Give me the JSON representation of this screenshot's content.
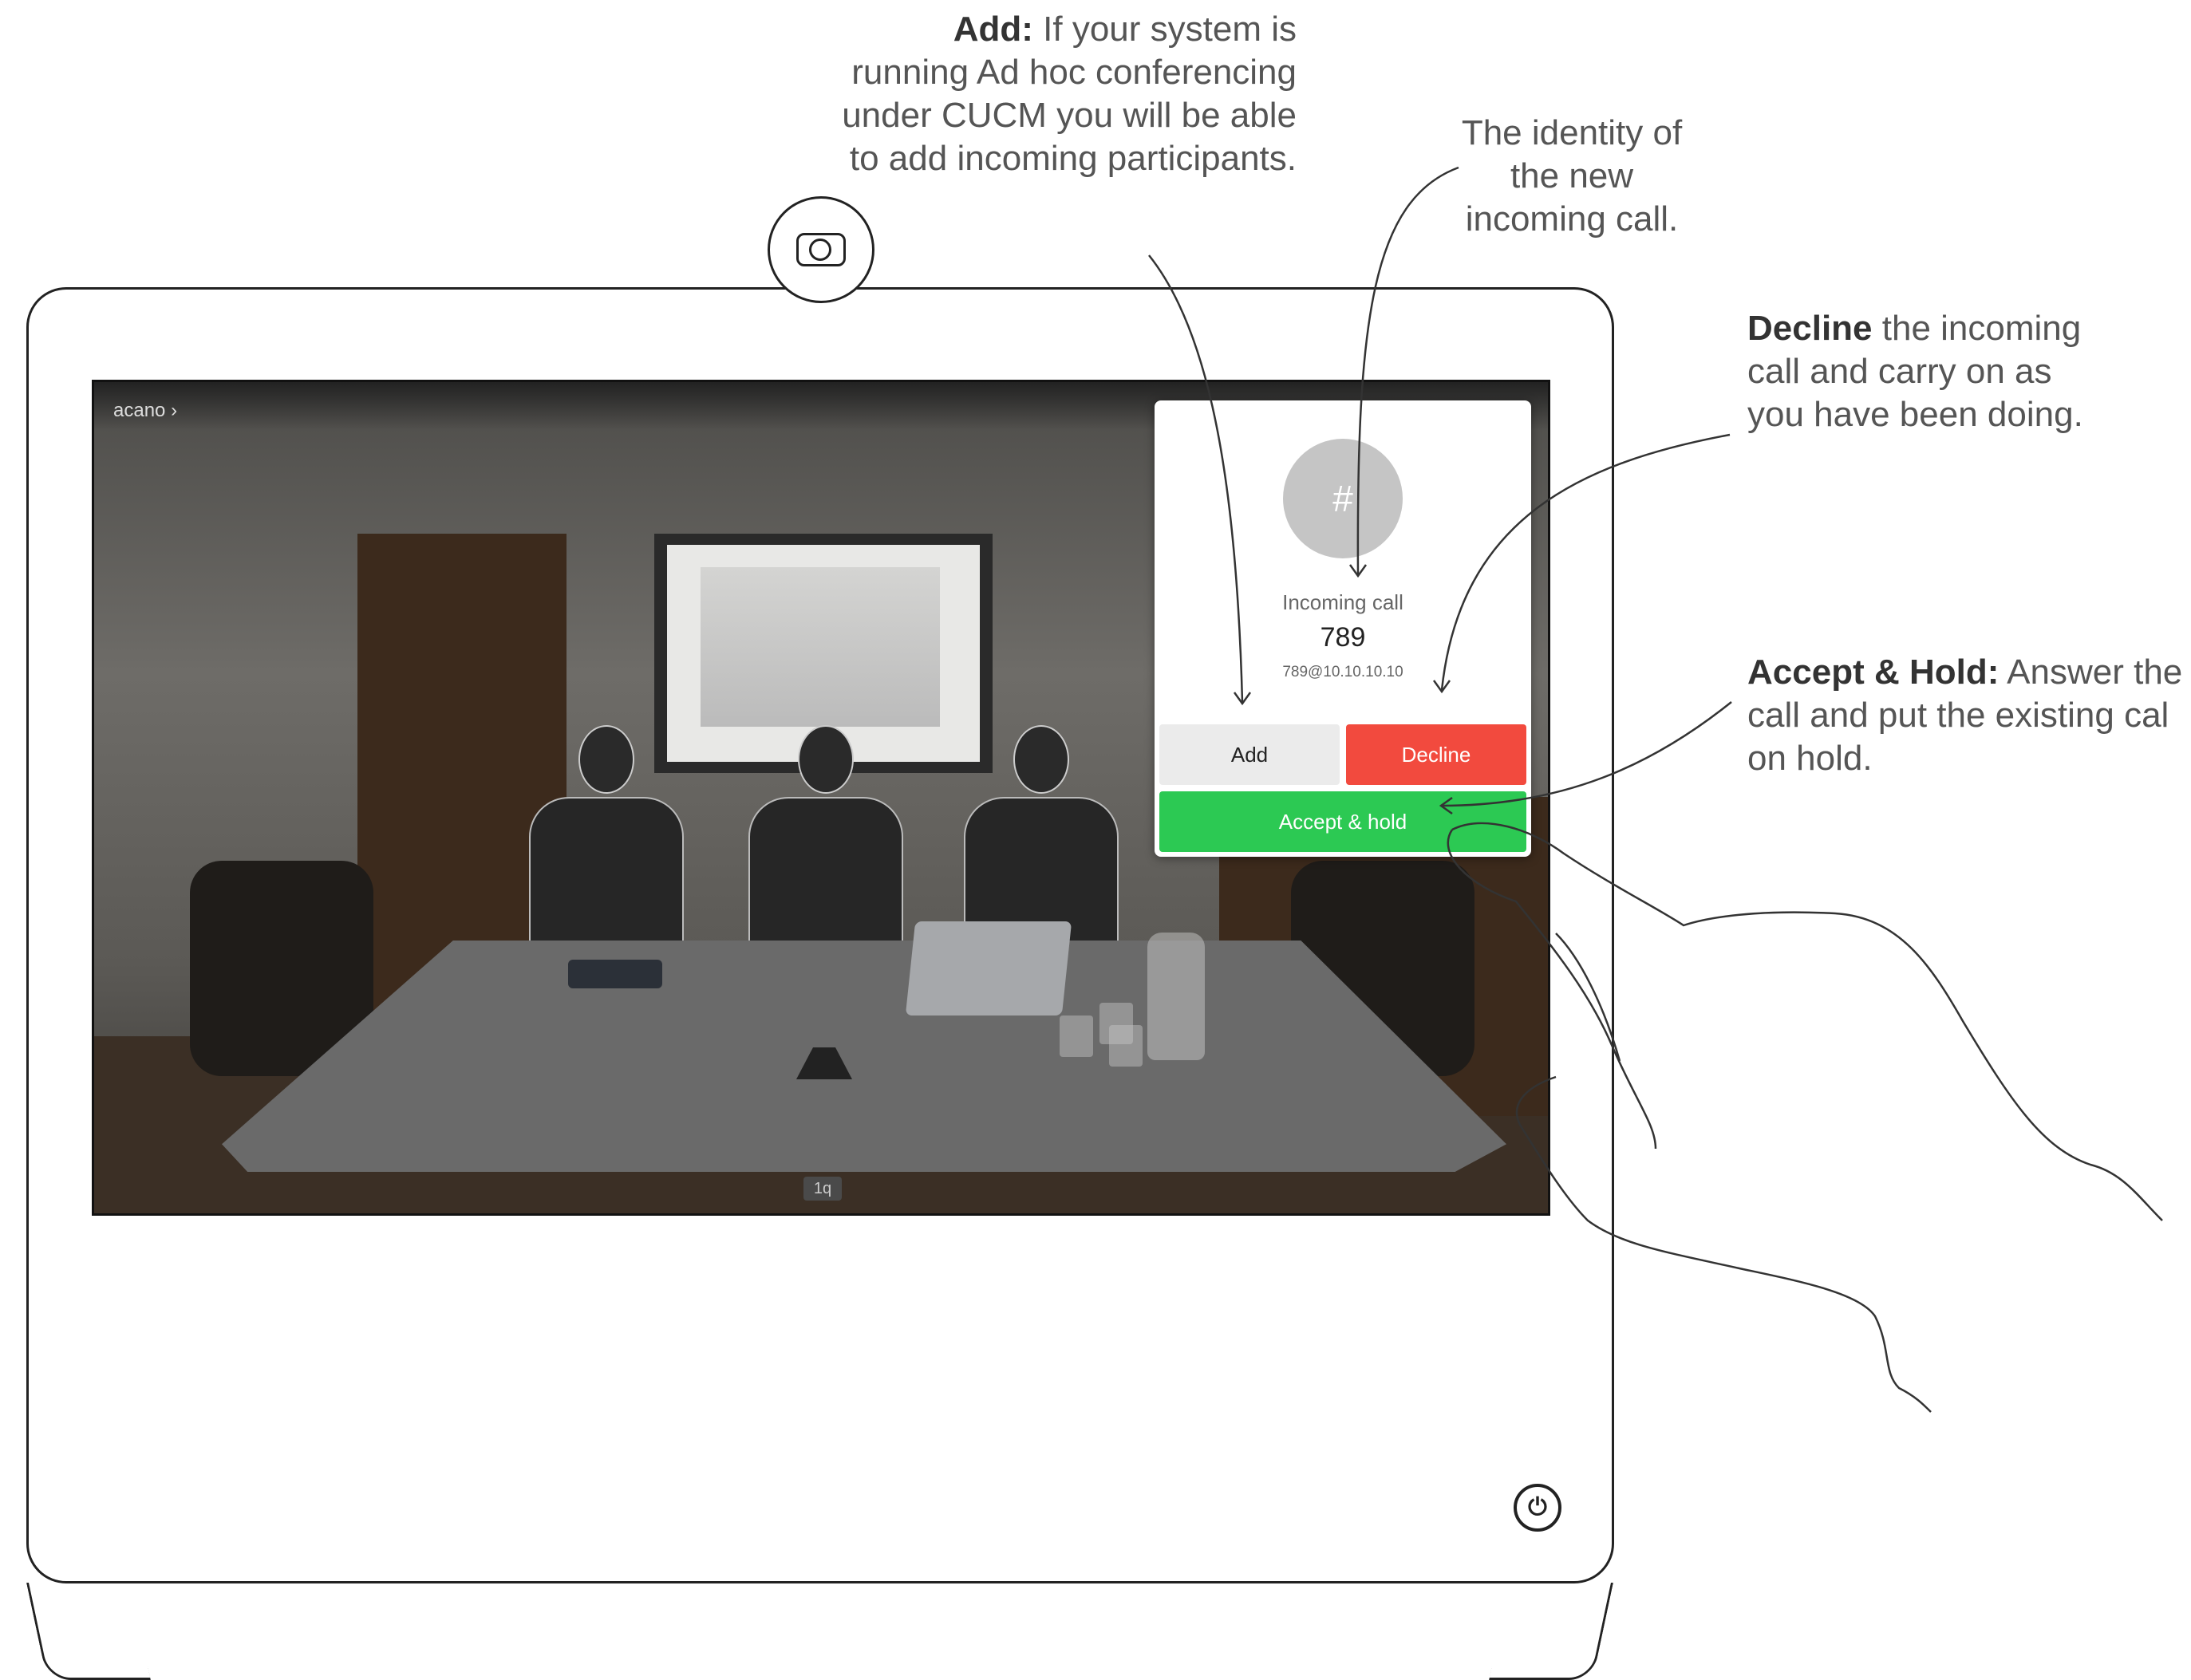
{
  "callouts": {
    "add_heading": "Add:",
    "add_text": "If your system is running Ad hoc conferencing under CUCM you will be able to add incoming participants.",
    "identity_text": "The identity of the new incoming call.",
    "decline_heading": "Decline",
    "decline_text": "the incoming call and carry on as you have been doing.",
    "accept_heading": "Accept & Hold:",
    "accept_text_line1": "Answer the",
    "accept_text_line2": "call and put the existing cal",
    "accept_text_line3": "on hold."
  },
  "screen": {
    "room_name": "acano",
    "room_chevron": "›",
    "page_indicator": "1q"
  },
  "incoming_call": {
    "avatar_glyph": "#",
    "label": "Incoming call",
    "number": "789",
    "uri": "789@10.10.10.10",
    "buttons": {
      "add": "Add",
      "decline": "Decline",
      "accept_hold": "Accept & hold"
    }
  },
  "colors": {
    "decline": "#f24a3e",
    "accept": "#2cc953",
    "add": "#ebebeb",
    "avatar": "#c5c5c5"
  },
  "icons": {
    "power": "power-icon",
    "camera": "camera-icon"
  }
}
